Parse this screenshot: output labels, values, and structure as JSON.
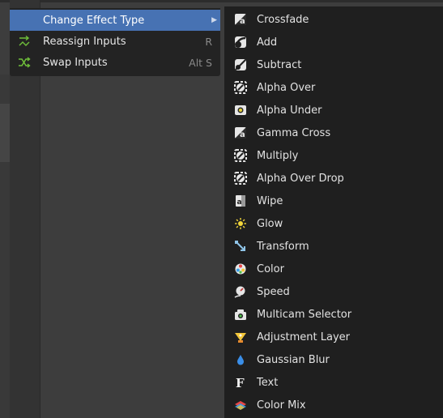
{
  "menu": {
    "items": [
      {
        "label": "Change Effect Type",
        "shortcut": "",
        "icon": "none",
        "active": true,
        "submenu_arrow": "▶"
      },
      {
        "label": "Reassign Inputs",
        "shortcut": "R",
        "icon": "reassign-icon"
      },
      {
        "label": "Swap Inputs",
        "shortcut": "Alt S",
        "icon": "swap-icon"
      }
    ]
  },
  "submenu": {
    "items": [
      {
        "label": "Crossfade",
        "icon": "crossfade-icon"
      },
      {
        "label": "Add",
        "icon": "add-icon"
      },
      {
        "label": "Subtract",
        "icon": "subtract-icon"
      },
      {
        "label": "Alpha Over",
        "icon": "alpha-over-icon"
      },
      {
        "label": "Alpha Under",
        "icon": "alpha-under-icon"
      },
      {
        "label": "Gamma Cross",
        "icon": "gamma-cross-icon"
      },
      {
        "label": "Multiply",
        "icon": "multiply-icon"
      },
      {
        "label": "Alpha Over Drop",
        "icon": "alpha-over-drop-icon"
      },
      {
        "label": "Wipe",
        "icon": "wipe-icon"
      },
      {
        "label": "Glow",
        "icon": "glow-icon"
      },
      {
        "label": "Transform",
        "icon": "transform-icon"
      },
      {
        "label": "Color",
        "icon": "color-icon"
      },
      {
        "label": "Speed",
        "icon": "speed-icon"
      },
      {
        "label": "Multicam Selector",
        "icon": "multicam-icon"
      },
      {
        "label": "Adjustment Layer",
        "icon": "adjustment-layer-icon"
      },
      {
        "label": "Gaussian Blur",
        "icon": "gaussian-blur-icon"
      },
      {
        "label": "Text",
        "icon": "text-icon"
      },
      {
        "label": "Color Mix",
        "icon": "color-mix-icon"
      }
    ]
  },
  "colors": {
    "highlight": "#4772b3",
    "menu_bg": "#232323",
    "submenu_bg": "#1f1f1f",
    "text": "#e2e2e2",
    "shortcut": "#8a8a8a",
    "green_icon": "#6fbf3a"
  }
}
